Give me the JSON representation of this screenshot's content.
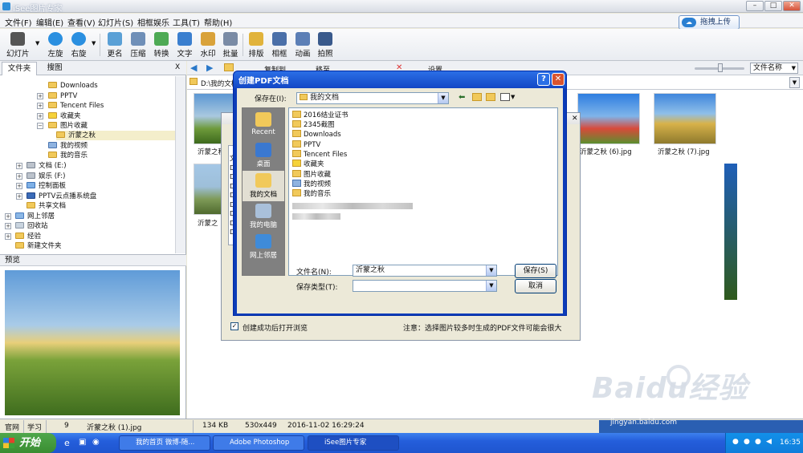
{
  "window": {
    "title": "iSee图片专家"
  },
  "upload_button": "拖拽上传",
  "menu": [
    "文件(F)",
    "编辑(E)",
    "查看(V)",
    "幻灯片(S)",
    "相框娱乐",
    "工具(T)",
    "帮助(H)"
  ],
  "toolbar": [
    "幻灯片",
    "左旋",
    "右旋",
    "更名",
    "压缩",
    "转换",
    "文字",
    "水印",
    "批量",
    "排版",
    "相框",
    "动画",
    "拍照"
  ],
  "left_tabs": [
    "文件夹",
    "搜图"
  ],
  "left_close": "X",
  "tree": [
    "Downloads",
    "PPTV",
    "Tencent Files",
    "收藏夹",
    "图片收藏",
    "沂蒙之秋",
    "我的视频",
    "我的音乐",
    "文档 (E:)",
    "娱乐 (F:)",
    "控制面板",
    "PPTV云点播系统盘",
    "共享文档",
    "网上邻居",
    "回收站",
    "经验",
    "新建文件夹"
  ],
  "preview_label": "预览",
  "main": {
    "path": "D:\\我的文档",
    "sort": "文件名称",
    "tool_labels": [
      "复制到",
      "移至",
      "设置"
    ],
    "thumbs": [
      "沂蒙之秋 (1).jpg",
      "沂蒙之秋 (6).jpg",
      "沂蒙之秋 (7).jpg",
      "沂蒙之"
    ]
  },
  "back_dialog": {
    "checkbox": "创建成功后打开浏览",
    "note": "注意：选择图片较多时生成的PDF文件可能会很大",
    "list_prefix": [
      "文",
      "D:",
      "D:",
      "D:",
      "D:",
      "D:",
      "D:",
      "D:",
      "D:"
    ]
  },
  "save_dialog": {
    "title": "创建PDF文档",
    "save_in_label": "保存在(I):",
    "save_in_value": "我的文档",
    "places": [
      "Recent",
      "桌面",
      "我的文档",
      "我的电脑",
      "网上邻居"
    ],
    "files": [
      "2016结业证书",
      "2345截图",
      "Downloads",
      "PPTV",
      "Tencent Files",
      "收藏夹",
      "图片收藏",
      "我的视频",
      "我的音乐"
    ],
    "filename_label": "文件名(N):",
    "filename_value": "沂蒙之秋",
    "filetype_label": "保存类型(T):",
    "filetype_value": "",
    "save_button": "保存(S)",
    "cancel_button": "取消"
  },
  "status": [
    "官网",
    "学习",
    "9",
    "沂蒙之秋 (1).jpg",
    "134 KB",
    "530x449",
    "2016-11-02 16:29:24"
  ],
  "taskbar": {
    "start": "开始",
    "tasks": [
      "我的首页 微博-随...",
      "Adobe Photoshop",
      "iSee图片专家"
    ],
    "clock": "16:35"
  },
  "watermark": {
    "text": "Baidu经验",
    "url": "jingyan.baidu.com"
  }
}
